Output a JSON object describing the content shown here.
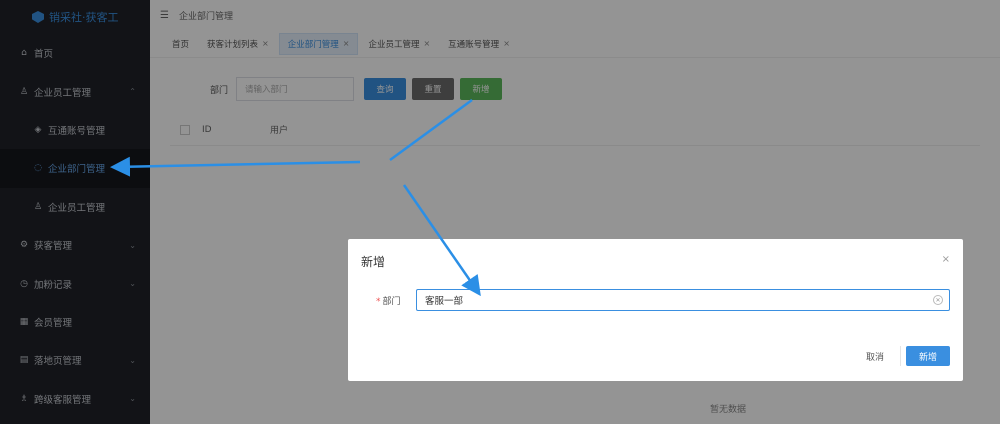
{
  "app": {
    "title": "销采社·获客工"
  },
  "sidebar": {
    "items": [
      {
        "icon": "home-icon",
        "glyph": "⌂",
        "label": "首页",
        "expandable": false
      },
      {
        "icon": "user-icon",
        "glyph": "♙",
        "label": "企业员工管理",
        "expandable": true,
        "expanded": true
      },
      {
        "icon": "box-icon",
        "glyph": "◈",
        "label": "互通账号管理",
        "sub": true
      },
      {
        "icon": "loading-icon",
        "glyph": "◌",
        "label": "企业部门管理",
        "sub": true,
        "active": true
      },
      {
        "icon": "user-icon",
        "glyph": "♙",
        "label": "企业员工管理",
        "sub": true
      },
      {
        "icon": "gear-icon",
        "glyph": "⚙",
        "label": "获客管理",
        "expandable": true
      },
      {
        "icon": "clock-icon",
        "glyph": "◷",
        "label": "加粉记录",
        "expandable": true
      },
      {
        "icon": "grid-icon",
        "glyph": "▦",
        "label": "会员管理",
        "expandable": false
      },
      {
        "icon": "list-icon",
        "glyph": "▤",
        "label": "落地页管理",
        "expandable": true
      },
      {
        "icon": "people-icon",
        "glyph": "♗",
        "label": "跨级客服管理",
        "expandable": true
      }
    ]
  },
  "topbar": {
    "breadcrumb": "企业部门管理"
  },
  "tabs": [
    {
      "label": "首页",
      "closable": false,
      "active": false
    },
    {
      "label": "获客计划列表",
      "closable": true,
      "active": false
    },
    {
      "label": "企业部门管理",
      "closable": true,
      "active": true
    },
    {
      "label": "企业员工管理",
      "closable": true,
      "active": false
    },
    {
      "label": "互通账号管理",
      "closable": true,
      "active": false
    }
  ],
  "filter": {
    "dept_label": "部门",
    "dept_placeholder": "请输入部门",
    "query_label": "查询",
    "reset_label": "重置",
    "add_label": "新增"
  },
  "table": {
    "col_id": "ID",
    "col_user": "用户",
    "empty_text": "暂无数据"
  },
  "dialog": {
    "title": "新增",
    "close_glyph": "×",
    "field_label": "部门",
    "field_value": "客服一部",
    "cancel_label": "取消",
    "confirm_label": "新增"
  },
  "colors": {
    "accent": "#3a8fe0",
    "add_button": "#5cb85c",
    "sidebar_bg": "#1f2229"
  }
}
